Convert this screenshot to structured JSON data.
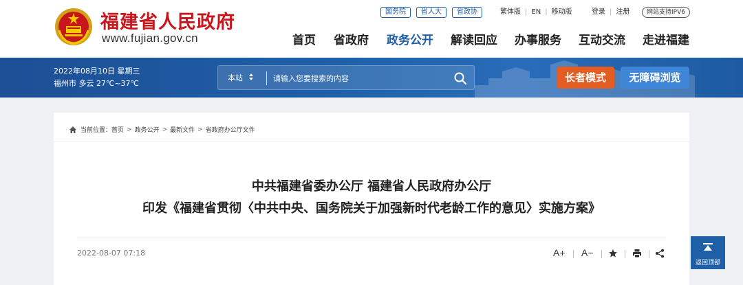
{
  "header": {
    "site_title": "福建省人民政府",
    "site_domain": "www.fujian.gov.cn",
    "top_links": [
      "国务院",
      "省人大",
      "省政协"
    ],
    "utility_links_left": [
      "繁体版",
      "EN",
      "移动版"
    ],
    "utility_links_right": [
      "登录",
      "注册"
    ],
    "ipv6_badge": "网站支持IPV6",
    "nav": [
      {
        "label": "首页",
        "active": false
      },
      {
        "label": "省政府",
        "active": false
      },
      {
        "label": "政务公开",
        "active": true
      },
      {
        "label": "解读回应",
        "active": false
      },
      {
        "label": "办事服务",
        "active": false
      },
      {
        "label": "互动交流",
        "active": false
      },
      {
        "label": "走进福建",
        "active": false
      }
    ]
  },
  "banner": {
    "date_text": "2022年08月10日 星期三",
    "weather_text": "福州市 多云 27℃~37℃",
    "search": {
      "scope": "本站",
      "placeholder": "请输入您要搜索的内容"
    },
    "elder_mode_label": "长者模式",
    "accessibility_label": "无障碍浏览"
  },
  "breadcrumb": {
    "prefix": "当前位置：",
    "items": [
      "首页",
      "政务公开",
      "最新文件",
      "省政府办公厅文件"
    ]
  },
  "article": {
    "title_line1": "中共福建省委办公厅 福建省人民政府办公厅",
    "title_line2": "印发《福建省贯彻〈中共中央、国务院关于加强新时代老龄工作的意见〉实施方案》",
    "publish_date": "2022-08-07 07:18",
    "tools": {
      "font_increase": "A+",
      "font_decrease": "A−"
    }
  },
  "back_to_top_label": "返回顶部",
  "colors": {
    "brand_red": "#c8161d",
    "brand_blue": "#1f5fa5",
    "elder_button": "#e35d22",
    "access_button": "#3f86d9"
  }
}
